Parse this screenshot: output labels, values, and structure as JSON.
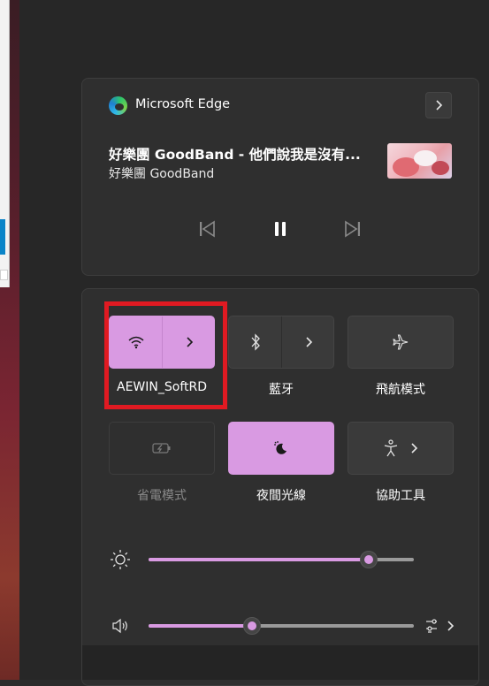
{
  "media": {
    "app_name": "Microsoft Edge",
    "song_title": "好樂團 GoodBand - 他們說我是沒有...",
    "artist": "好樂團 GoodBand",
    "icons": {
      "app": "edge-icon",
      "expand": "chevron-right-icon",
      "previous": "previous-track-icon",
      "pause": "pause-icon",
      "next": "next-track-icon"
    }
  },
  "quick_settings": {
    "tiles": [
      {
        "label": "AEWIN_SoftRD",
        "icon": "wifi-icon",
        "state": "on",
        "has_arrow": true
      },
      {
        "label": "藍牙",
        "icon": "bluetooth-icon",
        "state": "off",
        "has_arrow": true
      },
      {
        "label": "飛航模式",
        "icon": "airplane-icon",
        "state": "off",
        "has_arrow": false
      },
      {
        "label": "省電模式",
        "icon": "battery-saver-icon",
        "state": "disabled",
        "has_arrow": false
      },
      {
        "label": "夜間光線",
        "icon": "night-light-icon",
        "state": "on",
        "has_arrow": false
      },
      {
        "label": "協助工具",
        "icon": "accessibility-icon",
        "state": "off",
        "has_arrow": true
      }
    ],
    "brightness": {
      "value": 0.83,
      "icon": "brightness-icon"
    },
    "volume": {
      "value": 0.39,
      "icon": "speaker-icon",
      "settings_icon": "volume-mixer-icon"
    }
  },
  "colors": {
    "accent": "#d99ae2",
    "highlight": "#e01a22",
    "panel": "#2f2f2f"
  }
}
